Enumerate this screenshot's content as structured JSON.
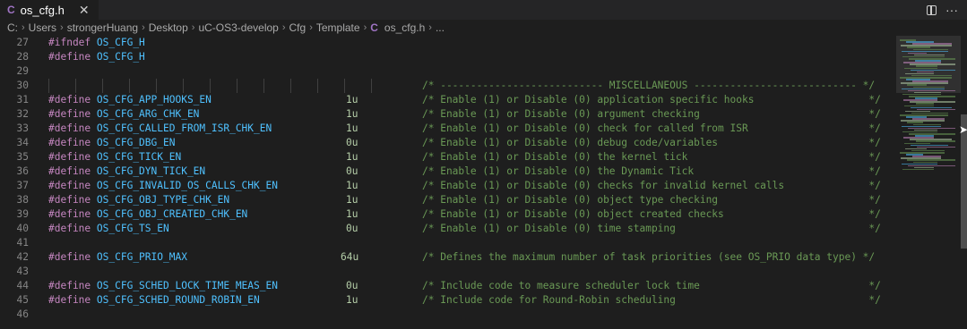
{
  "tab": {
    "icon": "C",
    "title": "os_cfg.h",
    "close": "✕"
  },
  "tab_actions": {
    "more": "···"
  },
  "breadcrumb": {
    "items": [
      "C:",
      "Users",
      "strongerHuang",
      "Desktop",
      "uC-OS3-develop",
      "Cfg",
      "Template"
    ],
    "file_icon": "C",
    "file": "os_cfg.h",
    "ellipsis": "..."
  },
  "lines": [
    {
      "n": "27",
      "kw": "#ifndef",
      "mac": "OS_CFG_H",
      "val": "",
      "cmt": ""
    },
    {
      "n": "28",
      "kw": "#define",
      "mac": "OS_CFG_H",
      "val": "",
      "cmt": ""
    },
    {
      "n": "29",
      "kw": "",
      "mac": "",
      "val": "",
      "cmt": ""
    },
    {
      "n": "30",
      "kw": "",
      "mac": "",
      "val": "",
      "cmt": "/* --------------------------- MISCELLANEOUS --------------------------- */"
    },
    {
      "n": "31",
      "kw": "#define",
      "mac": "OS_CFG_APP_HOOKS_EN",
      "val": "1u",
      "cmt": "/* Enable (1) or Disable (0) application specific hooks                   */"
    },
    {
      "n": "32",
      "kw": "#define",
      "mac": "OS_CFG_ARG_CHK_EN",
      "val": "1u",
      "cmt": "/* Enable (1) or Disable (0) argument checking                            */"
    },
    {
      "n": "33",
      "kw": "#define",
      "mac": "OS_CFG_CALLED_FROM_ISR_CHK_EN",
      "val": "1u",
      "cmt": "/* Enable (1) or Disable (0) check for called from ISR                    */"
    },
    {
      "n": "34",
      "kw": "#define",
      "mac": "OS_CFG_DBG_EN",
      "val": "0u",
      "cmt": "/* Enable (1) or Disable (0) debug code/variables                         */"
    },
    {
      "n": "35",
      "kw": "#define",
      "mac": "OS_CFG_TICK_EN",
      "val": "1u",
      "cmt": "/* Enable (1) or Disable (0) the kernel tick                              */"
    },
    {
      "n": "36",
      "kw": "#define",
      "mac": "OS_CFG_DYN_TICK_EN",
      "val": "0u",
      "cmt": "/* Enable (1) or Disable (0) the Dynamic Tick                             */"
    },
    {
      "n": "37",
      "kw": "#define",
      "mac": "OS_CFG_INVALID_OS_CALLS_CHK_EN",
      "val": "1u",
      "cmt": "/* Enable (1) or Disable (0) checks for invalid kernel calls              */"
    },
    {
      "n": "38",
      "kw": "#define",
      "mac": "OS_CFG_OBJ_TYPE_CHK_EN",
      "val": "1u",
      "cmt": "/* Enable (1) or Disable (0) object type checking                         */"
    },
    {
      "n": "39",
      "kw": "#define",
      "mac": "OS_CFG_OBJ_CREATED_CHK_EN",
      "val": "1u",
      "cmt": "/* Enable (1) or Disable (0) object created checks                        */"
    },
    {
      "n": "40",
      "kw": "#define",
      "mac": "OS_CFG_TS_EN",
      "val": "0u",
      "cmt": "/* Enable (1) or Disable (0) time stamping                                */"
    },
    {
      "n": "41",
      "kw": "",
      "mac": "",
      "val": "",
      "cmt": ""
    },
    {
      "n": "42",
      "kw": "#define",
      "mac": "OS_CFG_PRIO_MAX",
      "val": "64u",
      "cmt": "/* Defines the maximum number of task priorities (see OS_PRIO data type) */"
    },
    {
      "n": "43",
      "kw": "",
      "mac": "",
      "val": "",
      "cmt": ""
    },
    {
      "n": "44",
      "kw": "#define",
      "mac": "OS_CFG_SCHED_LOCK_TIME_MEAS_EN",
      "val": "0u",
      "cmt": "/* Include code to measure scheduler lock time                            */"
    },
    {
      "n": "45",
      "kw": "#define",
      "mac": "OS_CFG_SCHED_ROUND_ROBIN_EN",
      "val": "1u",
      "cmt": "/* Include code for Round-Robin scheduling                                */"
    },
    {
      "n": "46",
      "kw": "",
      "mac": "",
      "val": "",
      "cmt": ""
    }
  ],
  "colors": {
    "background": "#1e1e1e",
    "keyword": "#c586c0",
    "macro": "#4fc1ff",
    "number": "#b5cea8",
    "comment": "#6a9955",
    "line_number": "#858585"
  },
  "icons": [
    "c-file-icon",
    "close-icon",
    "split-editor-icon",
    "more-actions-icon",
    "chevron-right-icon"
  ]
}
